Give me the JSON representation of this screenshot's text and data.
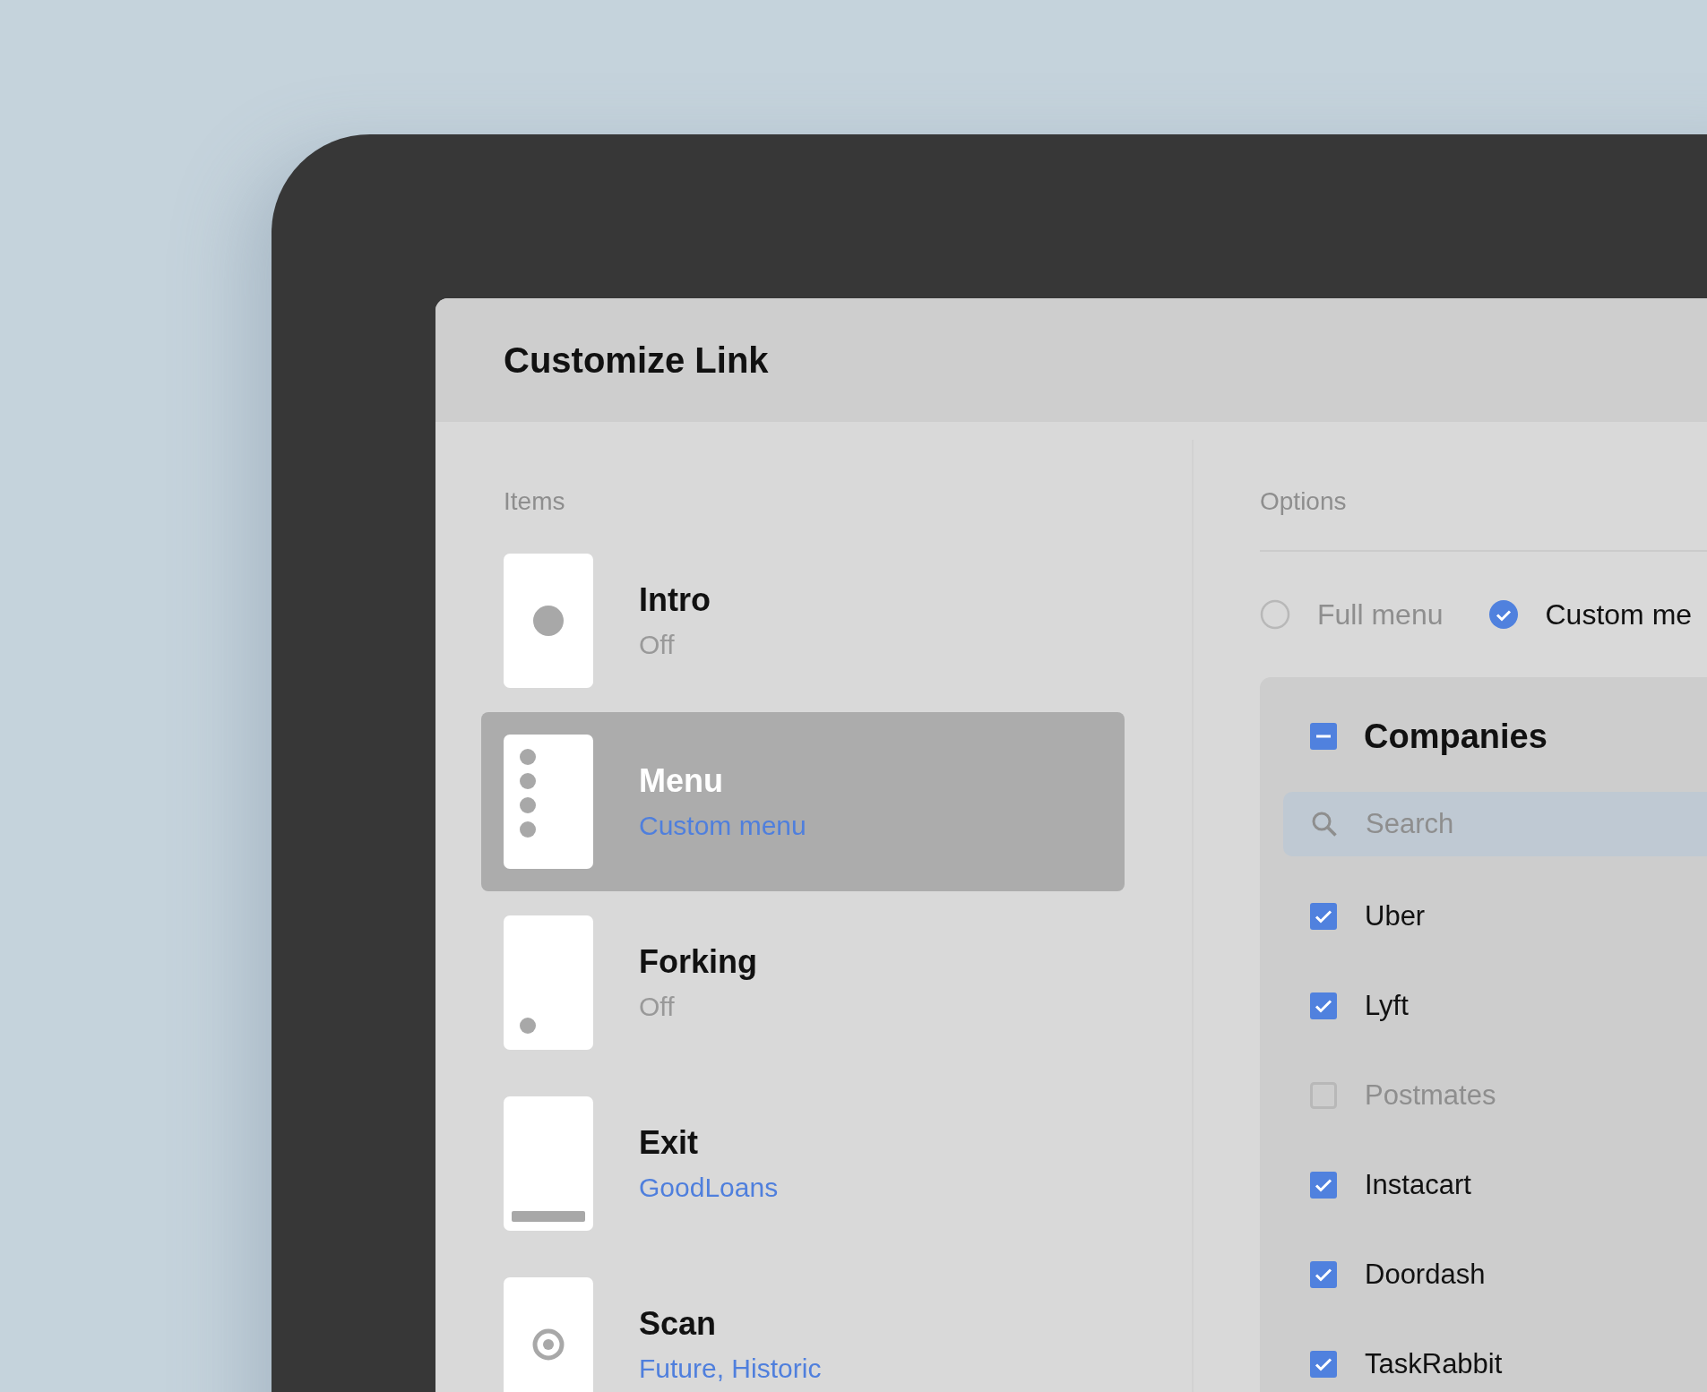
{
  "window": {
    "title": "Customize Link"
  },
  "items_panel": {
    "label": "Items",
    "items": [
      {
        "kind": "dot",
        "title": "Intro",
        "subtitle": "Off",
        "on": false,
        "selected": false
      },
      {
        "kind": "dots",
        "title": "Menu",
        "subtitle": "Custom menu",
        "on": true,
        "selected": true
      },
      {
        "kind": "corner-dot",
        "title": "Forking",
        "subtitle": "Off",
        "on": false,
        "selected": false
      },
      {
        "kind": "bar",
        "title": "Exit",
        "subtitle": "GoodLoans",
        "on": true,
        "selected": false
      },
      {
        "kind": "target",
        "title": "Scan",
        "subtitle": "Future, Historic",
        "on": true,
        "selected": false
      }
    ]
  },
  "options_panel": {
    "label": "Options",
    "modes": [
      {
        "label": "Full menu",
        "selected": false
      },
      {
        "label": "Custom me",
        "selected": true
      }
    ],
    "group": {
      "title": "Companies",
      "indeterminate": true,
      "search": {
        "placeholder": "Search"
      },
      "companies": [
        {
          "name": "Uber",
          "checked": true
        },
        {
          "name": "Lyft",
          "checked": true
        },
        {
          "name": "Postmates",
          "checked": false
        },
        {
          "name": "Instacart",
          "checked": true
        },
        {
          "name": "Doordash",
          "checked": true
        },
        {
          "name": "TaskRabbit",
          "checked": true
        }
      ]
    }
  }
}
